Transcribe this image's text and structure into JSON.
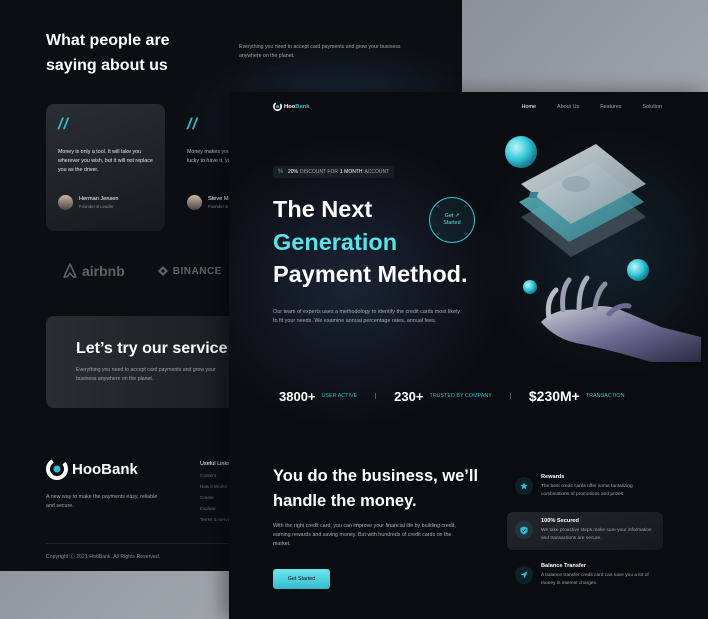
{
  "back": {
    "title": "What people are saying about us",
    "subtitle": "Everything you need to accept card payments and grow your business anywhere on the planet.",
    "testimonials": [
      {
        "text": "Money is only a tool. It will take you wherever you wish, but it will not replace you as the driver.",
        "name": "Herman Jensen",
        "role": "Founder & Leader"
      },
      {
        "text": "Money makes your life easier. If you're lucky to have it, you're lucky.",
        "name": "Steve Mark",
        "role": "Founder & Leader"
      }
    ],
    "logos": [
      "airbnb",
      "BINANCE"
    ],
    "cta": {
      "title": "Let’s try our service now!",
      "subtitle": "Everything you need to accept card payments and grow your business anywhere on the planet."
    },
    "footer": {
      "brand": "HooBank",
      "description": "A new way to make the payments easy, reliable and secure.",
      "useful_title": "Useful Links",
      "useful_links": [
        "Content",
        "How it Works",
        "Create",
        "Explore",
        "Terms & Services"
      ],
      "copyright": "Copyright Ⓒ 2021 HooBank. All Rights Reserved."
    }
  },
  "front": {
    "brand_hoo": "Hoo",
    "brand_bank": "Bank",
    "nav": [
      "Home",
      "About Us",
      "Features",
      "Solution"
    ],
    "discount": {
      "percent": "20%",
      "text": "DISCOUNT FOR",
      "highlight": "1 MONTH",
      "suffix": "ACCOUNT"
    },
    "hero": {
      "line1": "The Next",
      "line2": "Generation",
      "line3": "Payment Method.",
      "get_started_1": "Get ↗",
      "get_started_2": "Started",
      "description": "Our team of experts uses a methodology to identify the credit cards most likely to fit your needs. We examine annual percentage rates, annual fees."
    },
    "stats": [
      {
        "value": "3800+",
        "label": "USER ACTIVE"
      },
      {
        "value": "230+",
        "label": "TRUSTED BY COMPANY"
      },
      {
        "value": "$230M+",
        "label": "TRANSACTION"
      }
    ],
    "business": {
      "title": "You do the business, we’ll handle the money.",
      "description": "With the right credit card, you can improve your financial life by building credit, earning rewards and saving money. But with hundreds of credit cards on the market.",
      "button": "Get Started"
    },
    "features": [
      {
        "icon": "star-icon",
        "title": "Rewards",
        "desc": "The best credit cards offer some tantalizing combinations of promotions and prizes"
      },
      {
        "icon": "shield-icon",
        "title": "100% Secured",
        "desc": "We take proactive steps make sure your information and transactions are secure."
      },
      {
        "icon": "send-icon",
        "title": "Balance Transfer",
        "desc": "A balance transfer credit card can save you a lot of money in interest charges."
      }
    ]
  },
  "colors": {
    "accent": "#33bbcf",
    "accent_light": "#5ce1e6",
    "background": "#0a0c10"
  }
}
